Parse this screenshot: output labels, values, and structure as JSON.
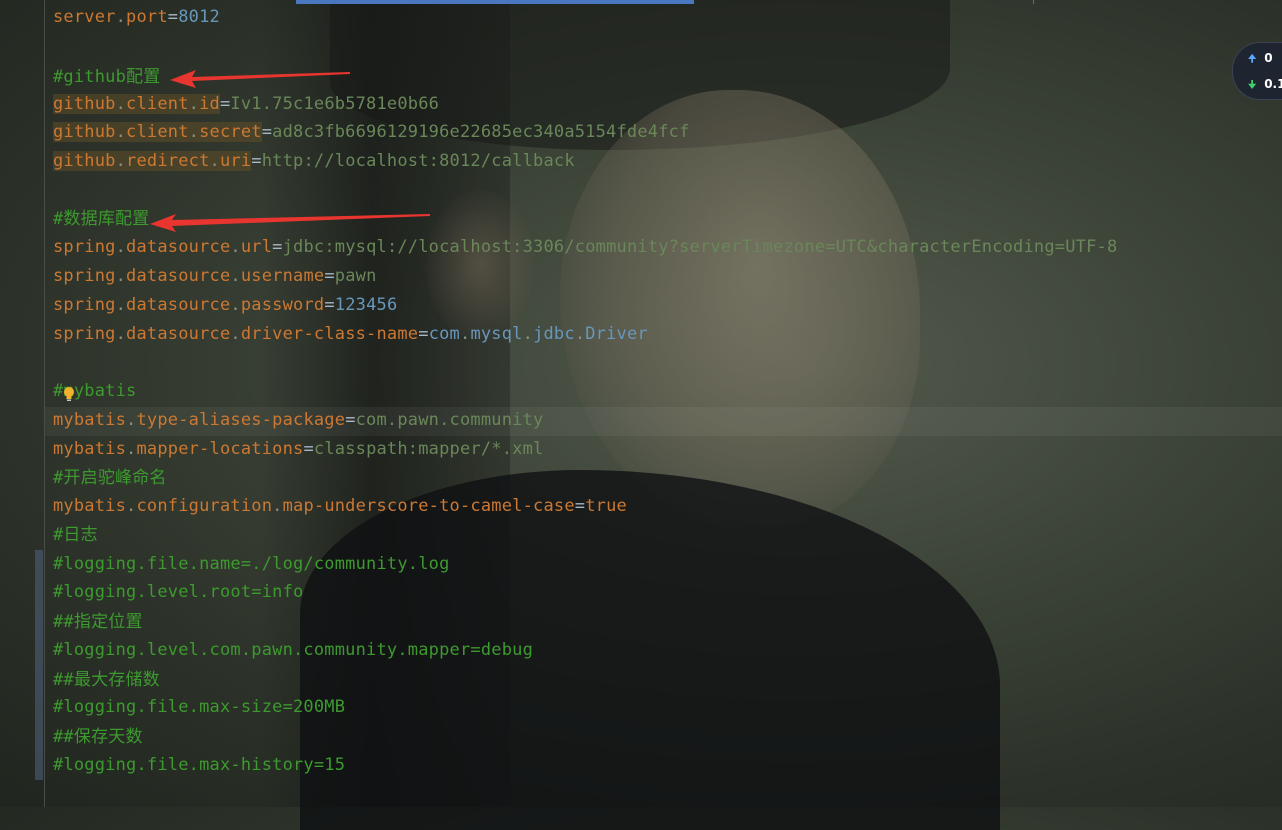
{
  "editor": {
    "lines": [
      {
        "key": [
          "server",
          "port"
        ],
        "value": "8012",
        "vtype": "num"
      },
      {
        "comment": "#github配置"
      },
      {
        "key": [
          "github",
          "client",
          "id"
        ],
        "value": "Iv1.75c1e6b5781e0b66",
        "vtype": "str",
        "highlight": true
      },
      {
        "key": [
          "github",
          "client",
          "secret"
        ],
        "value": "ad8c3fb6696129196e22685ec340a5154fde4fcf",
        "vtype": "str",
        "highlight": true
      },
      {
        "key": [
          "github",
          "redirect",
          "uri"
        ],
        "value": "http://localhost:8012/callback",
        "vtype": "str",
        "highlight": true
      },
      {
        "comment": "#数据库配置"
      },
      {
        "key": [
          "spring",
          "datasource",
          "url"
        ],
        "value": "jdbc:mysql://localhost:3306/community?serverTimezone=UTC&characterEncoding=UTF-8",
        "vtype": "str"
      },
      {
        "key": [
          "spring",
          "datasource",
          "username"
        ],
        "value": "pawn",
        "vtype": "str"
      },
      {
        "key": [
          "spring",
          "datasource",
          "password"
        ],
        "value": "123456",
        "vtype": "num"
      },
      {
        "key": [
          "spring",
          "datasource",
          "driver-class-name"
        ],
        "value": "com.mysql.jdbc.Driver",
        "vtype": "cls"
      },
      {
        "comment": "#mybatis"
      },
      {
        "key": [
          "mybatis",
          "type-aliases-package"
        ],
        "value": "com.pawn.community",
        "vtype": "str"
      },
      {
        "key": [
          "mybatis",
          "mapper-locations"
        ],
        "value": "classpath:mapper/*.xml",
        "vtype": "str"
      },
      {
        "comment": "#开启驼峰命名"
      },
      {
        "key": [
          "mybatis",
          "configuration",
          "map-underscore-to-camel-case"
        ],
        "value": "true",
        "vtype": "kw"
      },
      {
        "comment": "#日志"
      },
      {
        "comment": "#logging.file.name=./log/community.log"
      },
      {
        "comment": "#logging.level.root=info"
      },
      {
        "comment": "##指定位置"
      },
      {
        "comment": "#logging.level.com.pawn.community.mapper=debug"
      },
      {
        "comment": "##最大存储数"
      },
      {
        "comment": "#logging.file.max-size=200MB"
      },
      {
        "comment": "##保存天数"
      },
      {
        "comment": "#logging.file.max-history=15"
      }
    ]
  },
  "net_widget": {
    "upload": "0",
    "download": "0.1"
  },
  "colors": {
    "key": "#cc7832",
    "string": "#6a8759",
    "number": "#6897bb",
    "comment": "#3d9a2f",
    "arrow": "#e8352f"
  },
  "icons": [
    "lightbulb-icon",
    "arrow-up-icon",
    "arrow-down-icon",
    "annotation-arrow"
  ]
}
